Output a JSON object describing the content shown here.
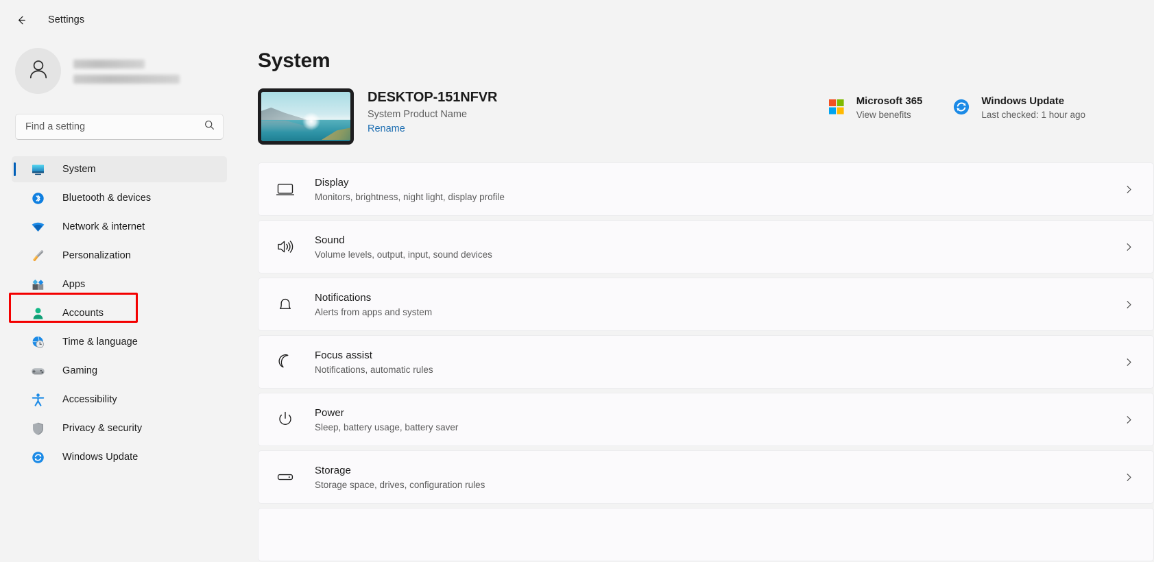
{
  "titlebar": {
    "back_icon": "back-arrow-icon",
    "app_title": "Settings"
  },
  "sidebar": {
    "profile": {
      "avatar_icon": "person-avatar-icon",
      "name_redacted": "",
      "email_redacted": ""
    },
    "search": {
      "placeholder": "Find a setting",
      "value": "",
      "icon": "search-icon"
    },
    "items": [
      {
        "label": "System",
        "icon": "system-monitor-icon",
        "selected": true
      },
      {
        "label": "Bluetooth & devices",
        "icon": "bluetooth-icon",
        "selected": false
      },
      {
        "label": "Network & internet",
        "icon": "wifi-icon",
        "selected": false
      },
      {
        "label": "Personalization",
        "icon": "paintbrush-icon",
        "selected": false,
        "highlighted": true
      },
      {
        "label": "Apps",
        "icon": "apps-grid-icon",
        "selected": false
      },
      {
        "label": "Accounts",
        "icon": "account-person-icon",
        "selected": false
      },
      {
        "label": "Time & language",
        "icon": "clock-globe-icon",
        "selected": false
      },
      {
        "label": "Gaming",
        "icon": "gamepad-icon",
        "selected": false
      },
      {
        "label": "Accessibility",
        "icon": "accessibility-icon",
        "selected": false
      },
      {
        "label": "Privacy & security",
        "icon": "shield-icon",
        "selected": false
      },
      {
        "label": "Windows Update",
        "icon": "update-refresh-icon",
        "selected": false
      }
    ]
  },
  "main": {
    "page_title": "System",
    "device": {
      "thumbnail_icon": "device-wallpaper-thumbnail",
      "name": "DESKTOP-151NFVR",
      "model": "System Product Name",
      "rename_label": "Rename"
    },
    "widgets": [
      {
        "title": "Microsoft 365",
        "subtitle": "View benefits",
        "icon": "microsoft-logo-icon"
      },
      {
        "title": "Windows Update",
        "subtitle": "Last checked: 1 hour ago",
        "icon": "update-refresh-icon"
      }
    ],
    "cards": [
      {
        "title": "Display",
        "subtitle": "Monitors, brightness, night light, display profile",
        "icon": "monitor-icon",
        "chevron": "chevron-right-icon"
      },
      {
        "title": "Sound",
        "subtitle": "Volume levels, output, input, sound devices",
        "icon": "speaker-icon",
        "chevron": "chevron-right-icon"
      },
      {
        "title": "Notifications",
        "subtitle": "Alerts from apps and system",
        "icon": "bell-icon",
        "chevron": "chevron-right-icon"
      },
      {
        "title": "Focus assist",
        "subtitle": "Notifications, automatic rules",
        "icon": "moon-icon",
        "chevron": "chevron-right-icon"
      },
      {
        "title": "Power",
        "subtitle": "Sleep, battery usage, battery saver",
        "icon": "power-icon",
        "chevron": "chevron-right-icon"
      },
      {
        "title": "Storage",
        "subtitle": "Storage space, drives, configuration rules",
        "icon": "hard-drive-icon",
        "chevron": "chevron-right-icon"
      }
    ]
  },
  "colors": {
    "accent": "#005fb8",
    "highlight": "#f30000",
    "link": "#1f6fb2",
    "window_bg": "#f3f3f3",
    "card_bg": "#fbfafc"
  }
}
